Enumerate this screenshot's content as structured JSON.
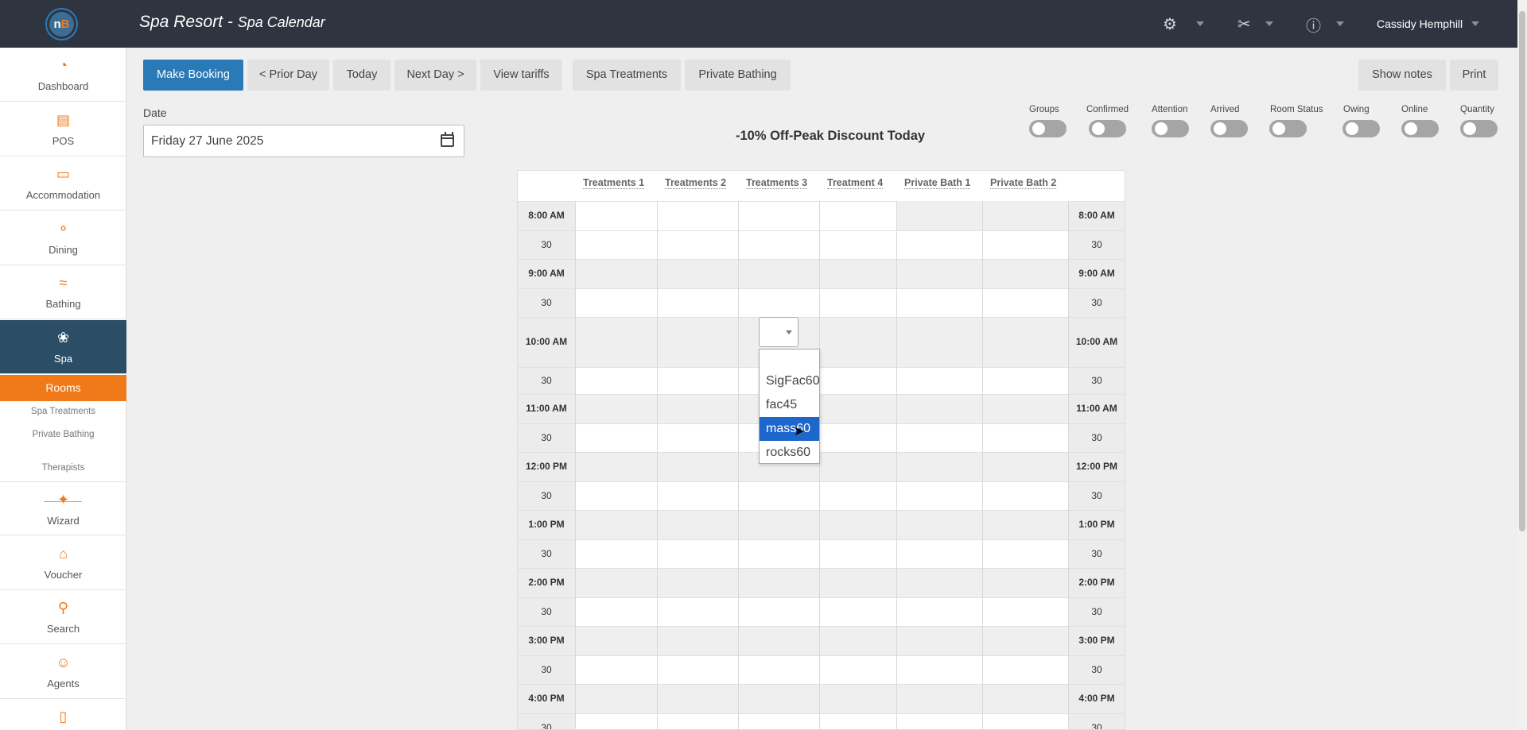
{
  "header": {
    "app_name": "Spa Resort - ",
    "page_name": "Spa Calendar",
    "user": "Cassidy Hemphill",
    "icons": [
      "settings-icon",
      "tools-icon",
      "help-icon"
    ]
  },
  "sidebar": {
    "items": [
      {
        "label": "Dashboard",
        "icon": "speedometer-icon"
      },
      {
        "label": "POS",
        "icon": "register-icon"
      },
      {
        "label": "Accommodation",
        "icon": "bed-icon"
      },
      {
        "label": "Dining",
        "icon": "dining-icon"
      },
      {
        "label": "Bathing",
        "icon": "waves-icon"
      },
      {
        "label": "Spa",
        "icon": "lotus-icon"
      },
      {
        "label": "Wizard",
        "icon": "wand-icon"
      },
      {
        "label": "Voucher",
        "icon": "gift-icon"
      },
      {
        "label": "Search",
        "icon": "search-icon"
      },
      {
        "label": "Agents",
        "icon": "agents-icon"
      }
    ],
    "sub_active": "Rooms",
    "sub_items": [
      "Spa Treatments",
      "Private Bathing",
      "Therapists"
    ]
  },
  "toolbar": {
    "make_booking": "Make Booking",
    "prior_day": "< Prior Day",
    "today": "Today",
    "next_day": "Next Day >",
    "view_tariffs": "View tariffs",
    "spa_treatments": "Spa Treatments",
    "private_bathing": "Private Bathing",
    "show_notes": "Show notes",
    "print": "Print"
  },
  "date": {
    "label": "Date",
    "value": "Friday 27 June 2025"
  },
  "discount": "-10% Off-Peak Discount Today",
  "toggles": [
    "Groups",
    "Confirmed",
    "Attention",
    "Arrived",
    "Room Status",
    "Owing",
    "Online",
    "Quantity"
  ],
  "calendar": {
    "columns": [
      "Treatments 1",
      "Treatments 2",
      "Treatments 3",
      "Treatment 4",
      "Private Bath 1",
      "Private Bath 2"
    ],
    "times": [
      "8:00 AM",
      "30",
      "9:00 AM",
      "30",
      "10:00 AM",
      "30",
      "11:00 AM",
      "30",
      "12:00 PM",
      "30",
      "1:00 PM",
      "30",
      "2:00 PM",
      "30",
      "3:00 PM",
      "30",
      "4:00 PM",
      "30"
    ]
  },
  "dropdown": {
    "options": [
      "SigFac60",
      "fac45",
      "mass60",
      "rocks60"
    ],
    "selected": "mass60"
  }
}
